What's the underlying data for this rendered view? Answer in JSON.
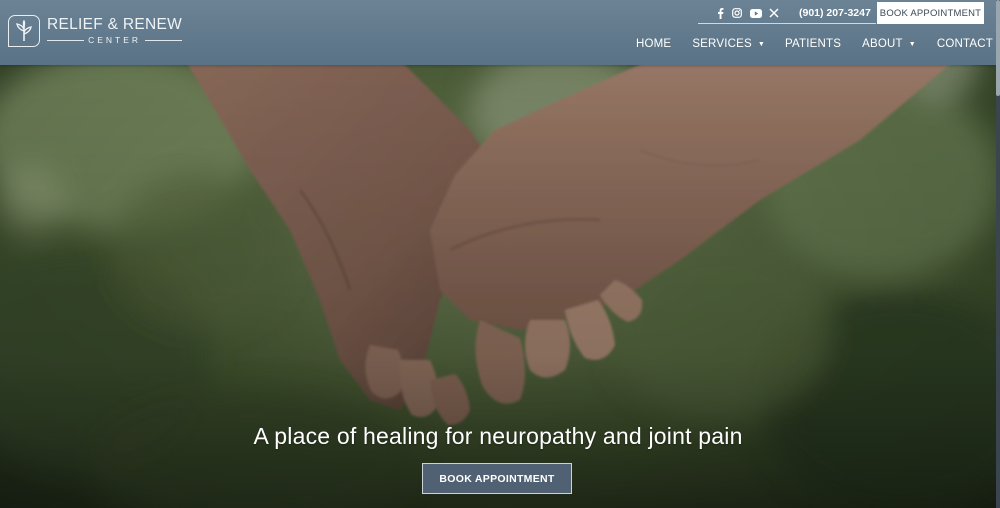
{
  "brand": {
    "name": "RELIEF & RENEW",
    "subtitle": "CENTER",
    "logo_icon": "leaf-sprout-icon"
  },
  "topbar": {
    "social": [
      "facebook-icon",
      "instagram-icon",
      "youtube-icon",
      "x-icon"
    ],
    "phone": "(901) 207-3247",
    "book_label": "BOOK APPOINTMENT"
  },
  "nav": {
    "items": [
      {
        "label": "HOME",
        "has_dropdown": false
      },
      {
        "label": "SERVICES",
        "has_dropdown": true
      },
      {
        "label": "PATIENTS",
        "has_dropdown": false
      },
      {
        "label": "ABOUT",
        "has_dropdown": true
      },
      {
        "label": "CONTACT",
        "has_dropdown": false
      }
    ],
    "caret": "▼"
  },
  "hero": {
    "headline": "A place of healing for neuropathy and joint pain",
    "cta_label": "BOOK APPOINTMENT"
  },
  "colors": {
    "header": "#5f788a",
    "cta": "#4f6172",
    "text": "#ffffff"
  }
}
